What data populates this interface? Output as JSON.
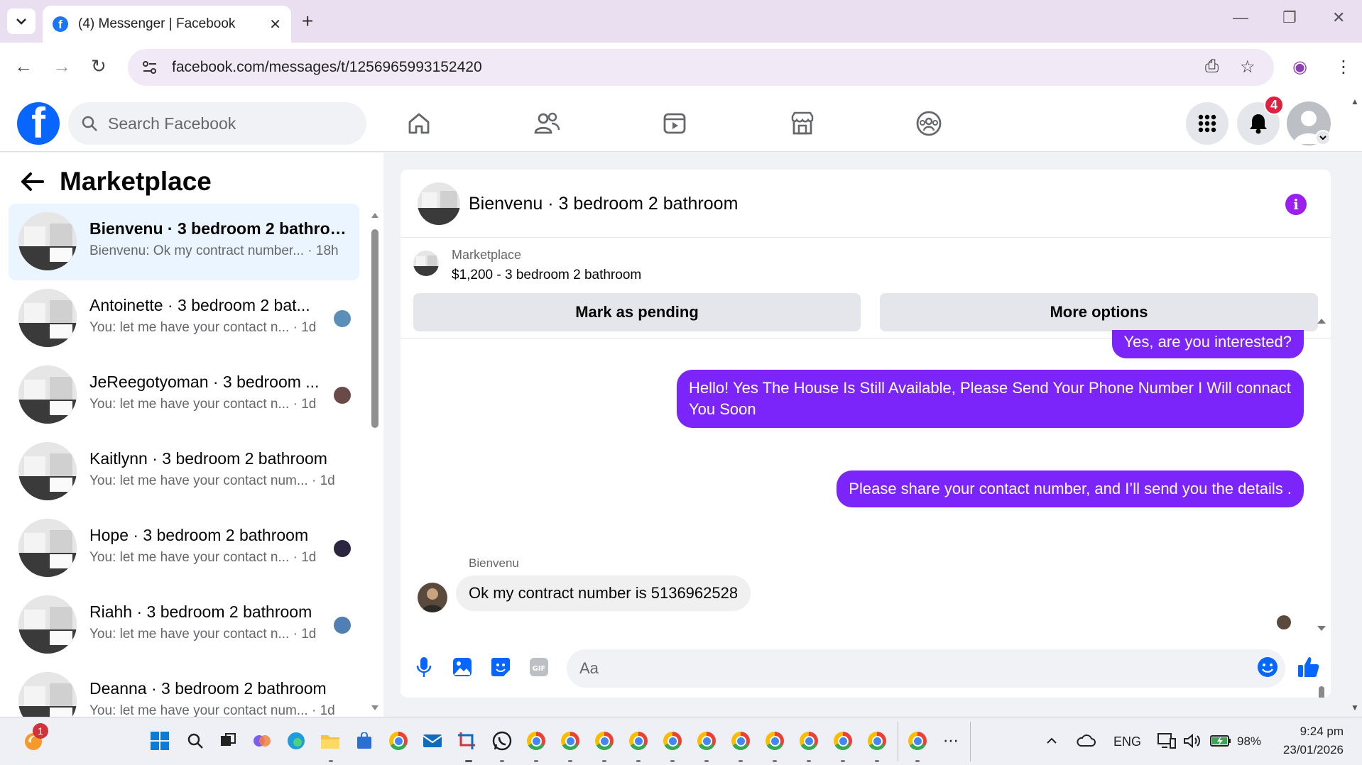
{
  "browser": {
    "tab_title": "(4) Messenger | Facebook",
    "url": "facebook.com/messages/t/1256965993152420"
  },
  "fb": {
    "search_placeholder": "Search Facebook",
    "notifications_count": "4"
  },
  "left_panel": {
    "title": "Marketplace",
    "conversations": [
      {
        "name": "Bienvenu · 3 bedroom 2 bathroo...",
        "preview": "Bienvenu: Ok my contract number...",
        "time": "18h",
        "active": true
      },
      {
        "name": "Antoinette · 3 bedroom 2 bat...",
        "preview": "You: let me have your contact n...",
        "time": "1d"
      },
      {
        "name": "JeReegotyoman · 3 bedroom ...",
        "preview": "You: let me have your contact n...",
        "time": "1d"
      },
      {
        "name": "Kaitlynn · 3 bedroom 2 bathroom",
        "preview": "You: let me have your contact num...",
        "time": "1d"
      },
      {
        "name": "Hope · 3 bedroom 2 bathroom",
        "preview": "You: let me have your contact n...",
        "time": "1d"
      },
      {
        "name": "Riahh · 3 bedroom 2 bathroom",
        "preview": "You: let me have your contact n...",
        "time": "1d"
      },
      {
        "name": "Deanna · 3 bedroom 2 bathroom",
        "preview": "You: let me have your contact num...",
        "time": "1d"
      }
    ]
  },
  "chat": {
    "title": "Bienvenu · 3 bedroom 2 bathroom",
    "marketplace_label": "Marketplace",
    "listing": "$1,200 - 3 bedroom 2 bathroom",
    "mark_pending": "Mark as pending",
    "more_options": "More options",
    "messages": {
      "out1": "Yes, are you interested?",
      "out2": "Hello! Yes The House  Is Still Available, Please Send Your Phone Number I Will connact You Soon",
      "out3": "Please share your contact number, and I’ll send you the details .",
      "sender": "Bienvenu",
      "in1": "Ok my  contract number is 5136962528"
    },
    "composer_placeholder": "Aa",
    "accent_color": "#7b25fb"
  },
  "taskbar": {
    "copilot_badge": "1",
    "language": "ENG",
    "battery": "98%",
    "time": "9:24 pm",
    "date": "23/01/2026"
  }
}
